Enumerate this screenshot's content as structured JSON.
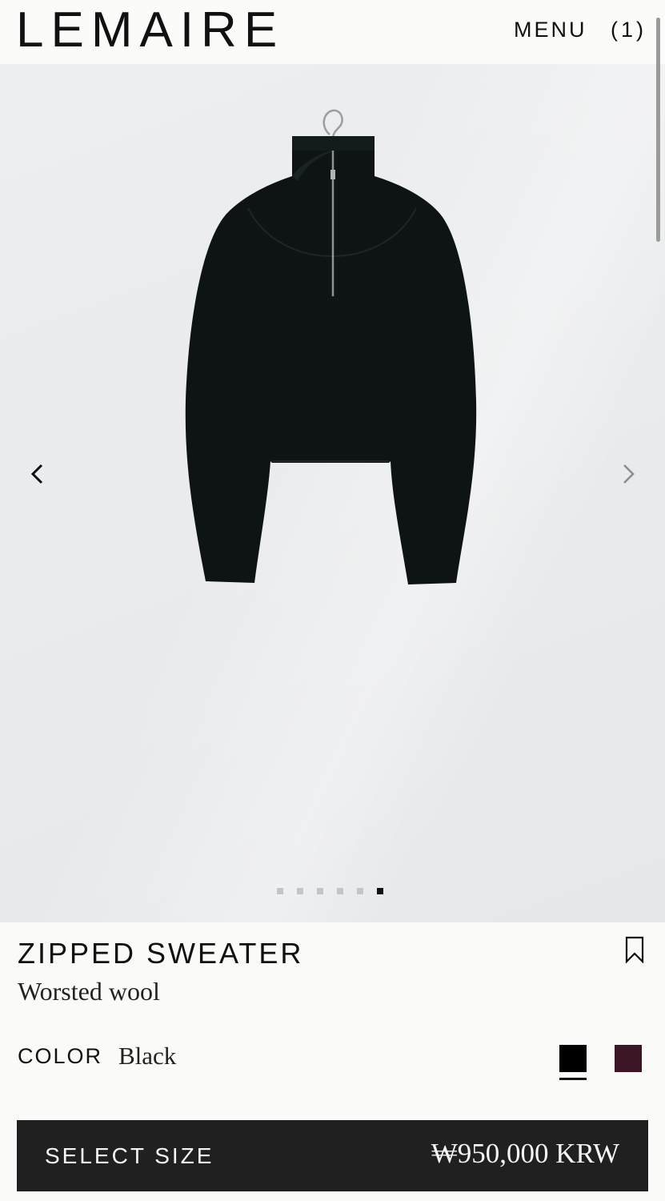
{
  "header": {
    "logo": "LEMAIRE",
    "menu_label": "MENU",
    "cart_label": "(1)"
  },
  "gallery": {
    "image_count": 6,
    "active_index": 5,
    "icons": {
      "prev": "chevron-left-icon",
      "next": "chevron-right-icon"
    }
  },
  "product": {
    "name": "ZIPPED SWEATER",
    "material": "Worsted wool",
    "color_label": "COLOR",
    "color_value": "Black",
    "swatches": [
      {
        "name": "Black",
        "hex": "#000000",
        "selected": true
      },
      {
        "name": "Plum",
        "hex": "#3c1527",
        "selected": false
      }
    ]
  },
  "cta": {
    "label": "SELECT SIZE",
    "price": "₩950,000 KRW"
  },
  "colors": {
    "cta_background": "#212020",
    "page_background": "#fafaf8",
    "garment": "#0e1414"
  }
}
